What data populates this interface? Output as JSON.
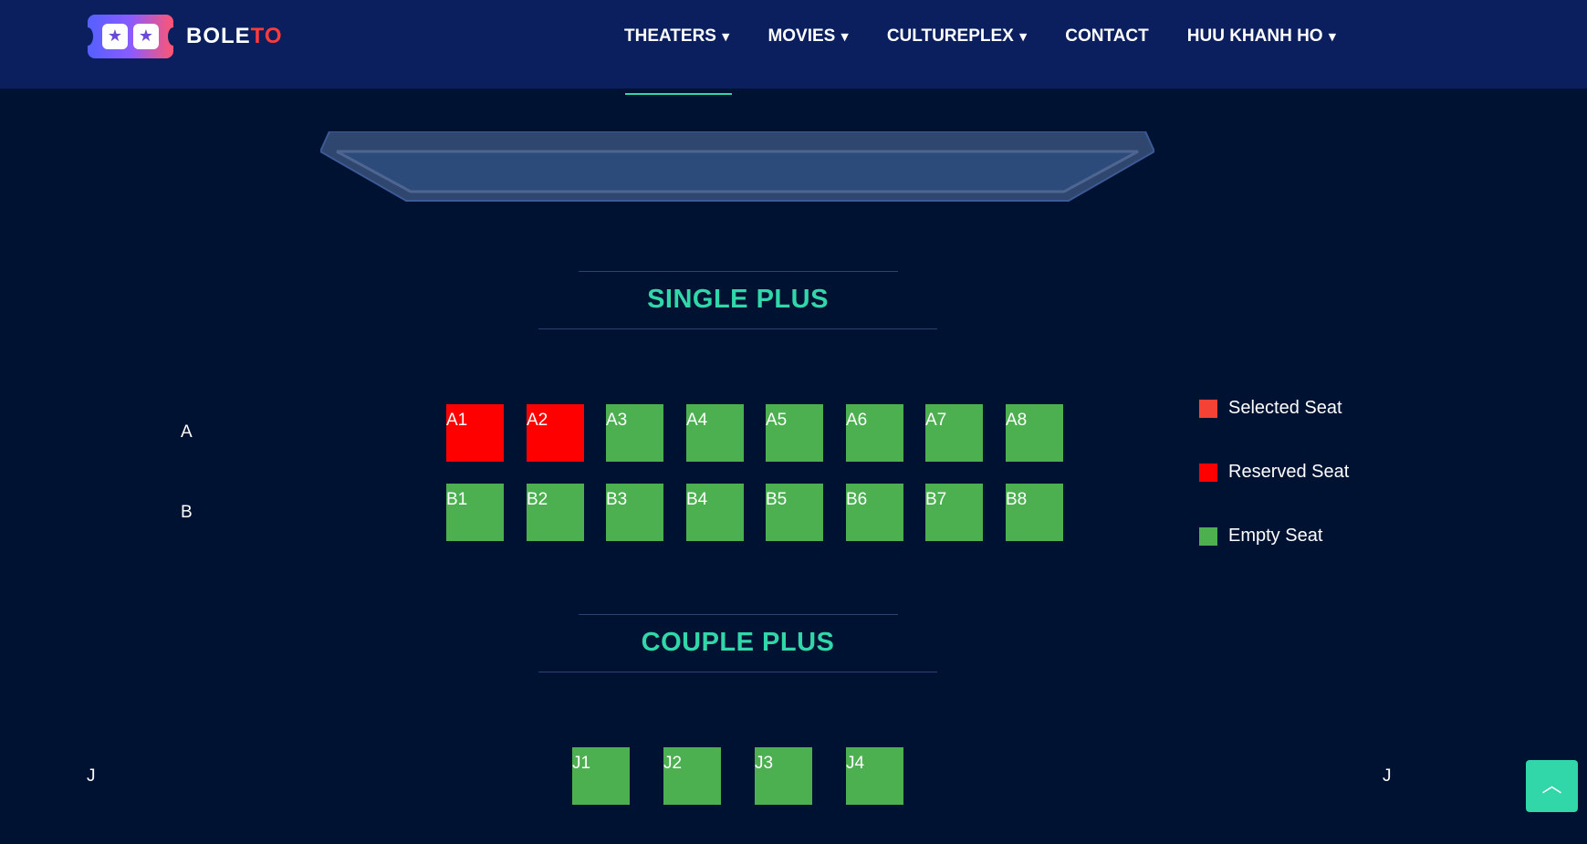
{
  "header": {
    "brand_part1": "BOLE",
    "brand_part2": "TO",
    "nav": [
      {
        "label": "THEATERS",
        "has_dropdown": true
      },
      {
        "label": "MOVIES",
        "has_dropdown": true
      },
      {
        "label": "CULTUREPLEX",
        "has_dropdown": true
      },
      {
        "label": "CONTACT",
        "has_dropdown": false
      },
      {
        "label": "HUU KHANH HO",
        "has_dropdown": true
      }
    ]
  },
  "colors": {
    "background": "#001232",
    "header": "#0b1f5e",
    "accent": "#31d7a9",
    "selected_seat": "#f44336",
    "reserved_seat": "#ff0000",
    "empty_seat": "#4caf50"
  },
  "sections": {
    "single": {
      "title": "SINGLE PLUS",
      "rows": [
        {
          "label": "A",
          "seats": [
            {
              "id": "A1",
              "status": "reserved"
            },
            {
              "id": "A2",
              "status": "reserved"
            },
            {
              "id": "A3",
              "status": "empty"
            },
            {
              "id": "A4",
              "status": "empty"
            },
            {
              "id": "A5",
              "status": "empty"
            },
            {
              "id": "A6",
              "status": "empty"
            },
            {
              "id": "A7",
              "status": "empty"
            },
            {
              "id": "A8",
              "status": "empty"
            }
          ]
        },
        {
          "label": "B",
          "seats": [
            {
              "id": "B1",
              "status": "empty"
            },
            {
              "id": "B2",
              "status": "empty"
            },
            {
              "id": "B3",
              "status": "empty"
            },
            {
              "id": "B4",
              "status": "empty"
            },
            {
              "id": "B5",
              "status": "empty"
            },
            {
              "id": "B6",
              "status": "empty"
            },
            {
              "id": "B7",
              "status": "empty"
            },
            {
              "id": "B8",
              "status": "empty"
            }
          ]
        }
      ]
    },
    "couple": {
      "title": "COUPLE PLUS",
      "rows": [
        {
          "label": "J",
          "label_right": "J",
          "seats": [
            {
              "id": "J1",
              "status": "empty"
            },
            {
              "id": "J2",
              "status": "empty"
            },
            {
              "id": "J3",
              "status": "empty"
            },
            {
              "id": "J4",
              "status": "empty"
            }
          ]
        }
      ]
    }
  },
  "legend": [
    {
      "label": "Selected Seat",
      "color": "#f44336"
    },
    {
      "label": "Reserved Seat",
      "color": "#ff0000"
    },
    {
      "label": "Empty Seat",
      "color": "#4caf50"
    }
  ],
  "icons": {
    "back_to_top": "chevron-up-icon",
    "nav_dropdown": "chevron-down-icon",
    "logo": "ticket-star-icon"
  }
}
